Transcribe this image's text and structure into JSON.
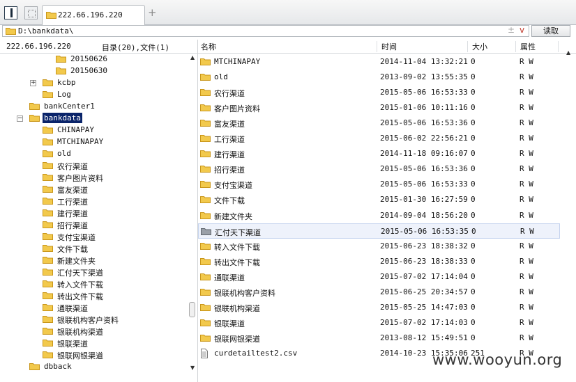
{
  "tabs": [
    {
      "label": "222.66.196.220"
    }
  ],
  "new_tab_symbol": "+",
  "address": {
    "path": "D:\\bankdata\\",
    "star_symbol": "±",
    "dropdown_symbol": "v",
    "read_button": "读取"
  },
  "left_header": {
    "host": "222.66.196.220",
    "count": "目录(20),文件(1)"
  },
  "tree": [
    {
      "label": "20150626",
      "indent": 80,
      "expander": ""
    },
    {
      "label": "20150630",
      "indent": 80,
      "expander": ""
    },
    {
      "label": "kcbp",
      "indent": 61,
      "expander": "+"
    },
    {
      "label": "Log",
      "indent": 61,
      "expander": ""
    },
    {
      "label": "bankCenter1",
      "indent": 42,
      "expander": ""
    },
    {
      "label": "bankdata",
      "indent": 42,
      "expander": "−",
      "selected": true
    },
    {
      "label": "CHINAPAY",
      "indent": 61,
      "expander": ""
    },
    {
      "label": "MTCHINAPAY",
      "indent": 61,
      "expander": ""
    },
    {
      "label": "old",
      "indent": 61,
      "expander": ""
    },
    {
      "label": "农行渠道",
      "indent": 61,
      "expander": ""
    },
    {
      "label": "客户图片资料",
      "indent": 61,
      "expander": ""
    },
    {
      "label": "富友渠道",
      "indent": 61,
      "expander": ""
    },
    {
      "label": "工行渠道",
      "indent": 61,
      "expander": ""
    },
    {
      "label": "建行渠道",
      "indent": 61,
      "expander": ""
    },
    {
      "label": "招行渠道",
      "indent": 61,
      "expander": ""
    },
    {
      "label": "支付宝渠道",
      "indent": 61,
      "expander": ""
    },
    {
      "label": "文件下载",
      "indent": 61,
      "expander": ""
    },
    {
      "label": "新建文件夹",
      "indent": 61,
      "expander": ""
    },
    {
      "label": "汇付天下渠道",
      "indent": 61,
      "expander": ""
    },
    {
      "label": "转入文件下载",
      "indent": 61,
      "expander": ""
    },
    {
      "label": "转出文件下载",
      "indent": 61,
      "expander": ""
    },
    {
      "label": "通联渠道",
      "indent": 61,
      "expander": ""
    },
    {
      "label": "银联机构客户资料",
      "indent": 61,
      "expander": ""
    },
    {
      "label": "银联机构渠道",
      "indent": 61,
      "expander": ""
    },
    {
      "label": "银联渠道",
      "indent": 61,
      "expander": ""
    },
    {
      "label": "银联网银渠道",
      "indent": 61,
      "expander": ""
    },
    {
      "label": "dbback",
      "indent": 42,
      "expander": ""
    }
  ],
  "columns": {
    "name": "名称",
    "time": "时间",
    "size": "大小",
    "attr": "属性"
  },
  "files": [
    {
      "name": "MTCHINAPAY",
      "time": "2014-11-04 13:32:21",
      "size": "0",
      "attr": "R W",
      "type": "folder"
    },
    {
      "name": "old",
      "time": "2013-09-02 13:55:35",
      "size": "0",
      "attr": "R W",
      "type": "folder"
    },
    {
      "name": "农行渠道",
      "time": "2015-05-06 16:53:33",
      "size": "0",
      "attr": "R W",
      "type": "folder"
    },
    {
      "name": "客户图片资料",
      "time": "2015-01-06 10:11:16",
      "size": "0",
      "attr": "R W",
      "type": "folder"
    },
    {
      "name": "富友渠道",
      "time": "2015-05-06 16:53:36",
      "size": "0",
      "attr": "R W",
      "type": "folder"
    },
    {
      "name": "工行渠道",
      "time": "2015-06-02 22:56:21",
      "size": "0",
      "attr": "R W",
      "type": "folder"
    },
    {
      "name": "建行渠道",
      "time": "2014-11-18 09:16:07",
      "size": "0",
      "attr": "R W",
      "type": "folder"
    },
    {
      "name": "招行渠道",
      "time": "2015-05-06 16:53:36",
      "size": "0",
      "attr": "R W",
      "type": "folder"
    },
    {
      "name": "支付宝渠道",
      "time": "2015-05-06 16:53:33",
      "size": "0",
      "attr": "R W",
      "type": "folder"
    },
    {
      "name": "文件下载",
      "time": "2015-01-30 16:27:59",
      "size": "0",
      "attr": "R W",
      "type": "folder"
    },
    {
      "name": "新建文件夹",
      "time": "2014-09-04 18:56:20",
      "size": "0",
      "attr": "R W",
      "type": "folder"
    },
    {
      "name": "汇付天下渠道",
      "time": "2015-05-06 16:53:35",
      "size": "0",
      "attr": "R W",
      "type": "folder-highlighted",
      "highlighted": true
    },
    {
      "name": "转入文件下载",
      "time": "2015-06-23 18:38:32",
      "size": "0",
      "attr": "R W",
      "type": "folder"
    },
    {
      "name": "转出文件下载",
      "time": "2015-06-23 18:38:33",
      "size": "0",
      "attr": "R W",
      "type": "folder"
    },
    {
      "name": "通联渠道",
      "time": "2015-07-02 17:14:04",
      "size": "0",
      "attr": "R W",
      "type": "folder"
    },
    {
      "name": "银联机构客户资料",
      "time": "2015-06-25 20:34:57",
      "size": "0",
      "attr": "R W",
      "type": "folder"
    },
    {
      "name": "银联机构渠道",
      "time": "2015-05-25 14:47:03",
      "size": "0",
      "attr": "R W",
      "type": "folder"
    },
    {
      "name": "银联渠道",
      "time": "2015-07-02 17:14:03",
      "size": "0",
      "attr": "R W",
      "type": "folder"
    },
    {
      "name": "银联网银渠道",
      "time": "2013-08-12 15:49:51",
      "size": "0",
      "attr": "R W",
      "type": "folder"
    },
    {
      "name": "curdetailtest2.csv",
      "time": "2014-10-23 15:35:06",
      "size": "251",
      "attr": "R W",
      "type": "file"
    }
  ],
  "watermark": "www.wooyun.org",
  "colors": {
    "folder": "#f2c94c",
    "folder_edge": "#c9961a",
    "selection": "#0a246a",
    "row_highlight": "#eef2fb"
  }
}
